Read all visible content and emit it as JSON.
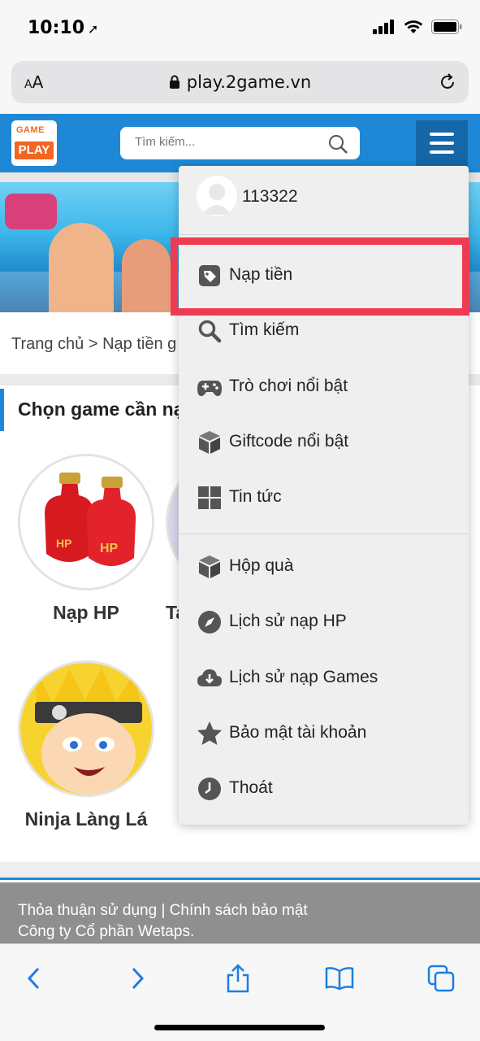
{
  "status_bar": {
    "time": "10:10"
  },
  "browser": {
    "aa_large": "A",
    "aa_small": "A",
    "url": "play.2game.vn"
  },
  "header": {
    "logo_top": "GAME",
    "logo_bottom": "PLAY",
    "search_placeholder": "Tìm kiếm..."
  },
  "breadcrumb": "Trang chủ > Nạp tiền g",
  "section_title": "Chọn game cần nạ",
  "games": [
    {
      "name": "Nạp HP",
      "badge": "HP"
    },
    {
      "name": "Ta"
    },
    {
      "name": "Ninja Làng Lá"
    }
  ],
  "footer": {
    "line1": "Thỏa thuận sử dụng | Chính sách bảo mật",
    "line2": "Công ty Cổ phần Wetaps."
  },
  "menu": {
    "username": "113322",
    "items": [
      {
        "label": "Nạp tiền",
        "icon": "tag-icon"
      },
      {
        "label": "Tìm kiếm",
        "icon": "search-icon"
      },
      {
        "label": "Trò chơi nổi bật",
        "icon": "gamepad-icon"
      },
      {
        "label": "Giftcode nổi bật",
        "icon": "cube-icon"
      },
      {
        "label": "Tin tức",
        "icon": "grid-icon"
      },
      {
        "label": "Hộp quà",
        "icon": "box-icon"
      },
      {
        "label": "Lịch sử nạp HP",
        "icon": "compass-icon"
      },
      {
        "label": "Lịch sử nạp Games",
        "icon": "cloud-download-icon"
      },
      {
        "label": "Bảo mật tài khoản",
        "icon": "star-icon"
      },
      {
        "label": "Thoát",
        "icon": "clock-icon"
      }
    ]
  },
  "colors": {
    "header_blue": "#1e88d6",
    "menu_button": "#1667a8",
    "highlight": "#ef3b52",
    "footer_gray": "#8f8f8f"
  }
}
